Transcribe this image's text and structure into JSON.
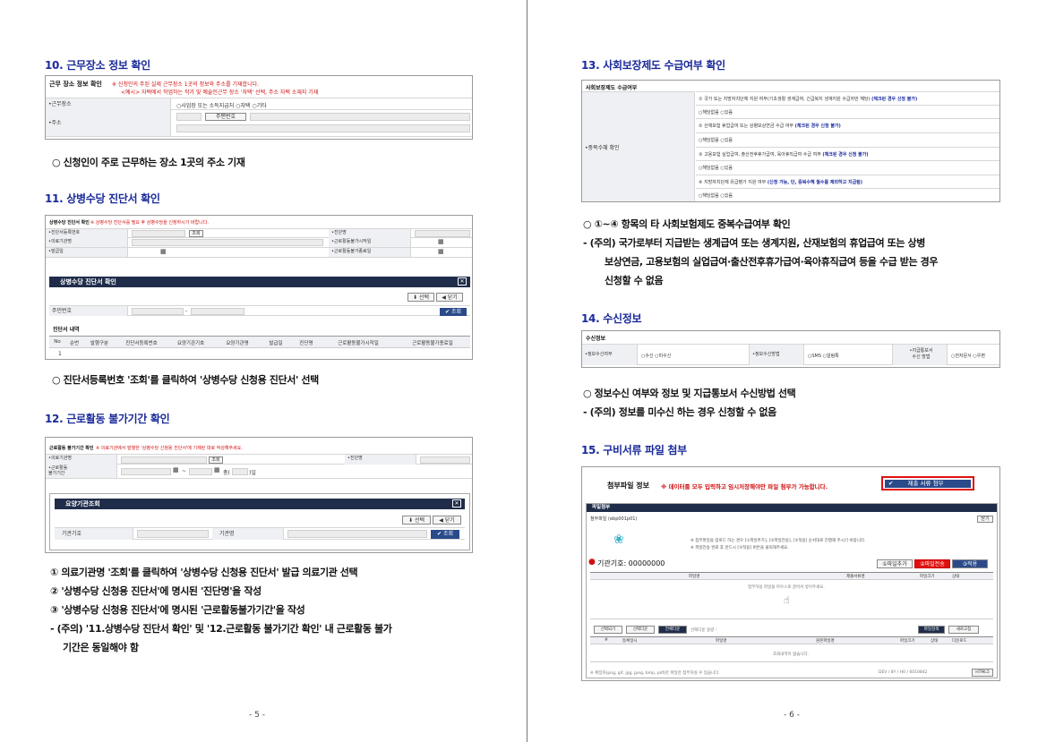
{
  "left": {
    "s10": {
      "heading": "10. 근무장소 정보 확인",
      "shot": {
        "title": "근무 장소 정보 확인",
        "note1": "※ 신청인의 주된 실제 근무장소 1곳의 정보와 주소를 기재합니다.",
        "note2": "<예시> 자택에서 작업하는 작가 및 예술인근무 장소 '자택' 선택, 주소 자택 소재지 기재",
        "workplace_label": "•근무장소",
        "workplace_options": "○사업장 또는 소득지급처  ○자택  ○기타",
        "address_label": "•주소",
        "zip_button": "주편번호"
      },
      "bullet": "○ 신청인이 주로 근무하는 장소 1곳의 주소 기재"
    },
    "s11": {
      "heading": "11. 상병수당 진단서 확인",
      "shot": {
        "title": "상병수당 진단서 확인",
        "note": "※ 상병수당 진단서를 필요 후 상병수당을 신청하시기 바랍니다.",
        "r1a": "•진단서등록번호",
        "r1btn": "조회",
        "r1b": "•진단명",
        "r2a": "•의료기관명",
        "r2b": "•근로활동불가시작일",
        "r3a": "•발급일",
        "r3b": "•근로활동불가종료일",
        "popup_title": "상병수당 진단서 확인",
        "select_btn": "선택",
        "close_btn": "닫기",
        "rrn_label": "주민번호",
        "dash": "-",
        "search_btn": "조회",
        "list_title": "진단서 내역",
        "columns": [
          "No",
          "순번",
          "발행구분",
          "진단서등록번호",
          "요양기관기호",
          "요양기관명",
          "발급일",
          "진단명",
          "근로활동불가시작일",
          "근로활동불가종료일"
        ],
        "first_no": "1"
      },
      "bullet": "○ 진단서등록번호 '조회'를 클릭하여 '상병수당 신청용 진단서' 선택"
    },
    "s12": {
      "heading": "12. 근로활동 불가기간 확인",
      "shot": {
        "title": "근로활동 불가기간 확인",
        "note": "※ 의료기관에서 발행한 '상병수당 신청용 진단서'에 기재된 대로 작성해주세요.",
        "r1a": "•의료기관명",
        "r1btn": "조회",
        "r1b": "•진단명",
        "r2a": "•근로활동\n불가기간",
        "tilde": "~",
        "days_prefix": "총(",
        "days_suffix": ")일",
        "popup_title": "요양기관조회",
        "select_btn": "선택",
        "close_btn": "닫기",
        "code_label": "기관기호",
        "name_label": "기관명",
        "search_btn": "조회"
      },
      "lines": [
        "① 의료기관명 '조회'를 클릭하여 '상병수당 신청용 진단서' 발급 의료기관 선택",
        "② '상병수당 신청용 진단서'에 명시된 '진단명'을 작성",
        "③ '상병수당 신청용 진단서'에 명시된 '근로활동불가기간'을 작성",
        "- (주의) '11.상병수당 진단서 확인' 및 '12.근로활동 불가기간 확인' 내 근로활동 불가",
        "기간은 동일해야 함"
      ]
    },
    "footer": "- 5 -"
  },
  "right": {
    "s13": {
      "heading": "13. 사회보장제도 수급여부 확인",
      "shot": {
        "title": "사회보장제도 수급여부",
        "side_label": "•중복수혜 확인",
        "items": [
          {
            "q": "① 국가 또는 지방자치단체 지원 여부(기초생활 생계급여, 긴급복지 생계지원 수급자만 해당)",
            "n": "(체크된 경우 신청 불가)"
          },
          {
            "q": "② 산재보험 휴업급여 또는 상병보상연금 수급 여부",
            "n": "(체크된 경우 신청 불가)"
          },
          {
            "q": "③ 고용보험 실업급여, 출산전후휴가급여, 육아휴직급여 수급 여부",
            "n": "(체크된 경우 신청 불가)"
          },
          {
            "q": "④ 지방자치단체 유급병가 지원 여부",
            "n": "(신청 가능, 단, 중복수혜 월수를 제외하고 지급됨)"
          }
        ],
        "options": "○해당없음  ○있음"
      },
      "lines": [
        "○ ①~④ 항목의 타 사회보험제도 중복수급여부 확인",
        "- (주의) 국가로부터 지급받는 생계급여 또는 생계지원, 산재보험의 휴업급여 또는 상병",
        "보상연금, 고용보험의 실업급여·출산전후휴가급여·육아휴직급여 등을 수급 받는 경우",
        "신청할 수 없음"
      ]
    },
    "s14": {
      "heading": "14. 수신정보",
      "shot": {
        "title": "수신정보",
        "c1_label": "•정보수신여부",
        "c1_opts": "○수신  ○미수신",
        "c2_label": "•정보수신방법",
        "c2_opts": "○SMS  ○알림톡",
        "c3_label": "•지급통보서\n수신 방법",
        "c3_opts": "○전자문서  ○우편"
      },
      "lines": [
        "○ 정보수신 여부와 정보 및 지급통보서 수신방법 선택",
        "- (주의) 정보를 미수신 하는 경우 신청할 수 없음"
      ]
    },
    "s15": {
      "heading": "15. 구비서류 파일 첨부",
      "shot": {
        "title": "첨부파일 정보",
        "notice": "※ 데이터를 모두 입력하고 임시저장해야만 파일 첨부가 가능합니다.",
        "submit_btn": "제출 서류 첨부",
        "panel_tab": "파일첨부",
        "panel_sub": "첨부파일 (ebp001p01)",
        "close_btn": "닫기",
        "desc1": "※ 첨부파일을 업로드 하는 경우 [①파일추가], [②파일전송], [③적용] 순서대로 진행해 주시기 바랍니다.",
        "desc2": "※ 파일전송 완료 후 반드시 [③적용] 버튼을 클릭해주세요.",
        "org_code": "기관기호: 00000000",
        "add_btn": "①파일추가",
        "send_btn": "②파일전송",
        "apply_btn": "③적용",
        "h_filename": "파일명",
        "h_docname": "제출서류명",
        "h_size": "파일크기",
        "h_status": "상태",
        "drop_text": "첨부하실 파일을 마우스로 끌어서 넣어주세요.",
        "tool_btns": [
          "선택되기",
          "선택다운",
          "전체다운"
        ],
        "selected_cap": "선택다운 용량 :",
        "search_btn": "파일검색",
        "refresh_btn": "새로고침",
        "cols2": [
          "#",
          "등록일시",
          "파일명",
          "원본파일명",
          "파일크기",
          "상태",
          "다운로드"
        ],
        "empty_text": "조회내역이 없습니다.",
        "bottom_note": "※ 확장자(png, gif, jpg, jpeg, bmp, pdf)만 파일만 첨부하실 수 있습니다.",
        "bottom_right": "DEV / 8Y / H0 / 6010842",
        "bottom_tag": "HTML5"
      }
    },
    "footer": "- 6 -"
  }
}
